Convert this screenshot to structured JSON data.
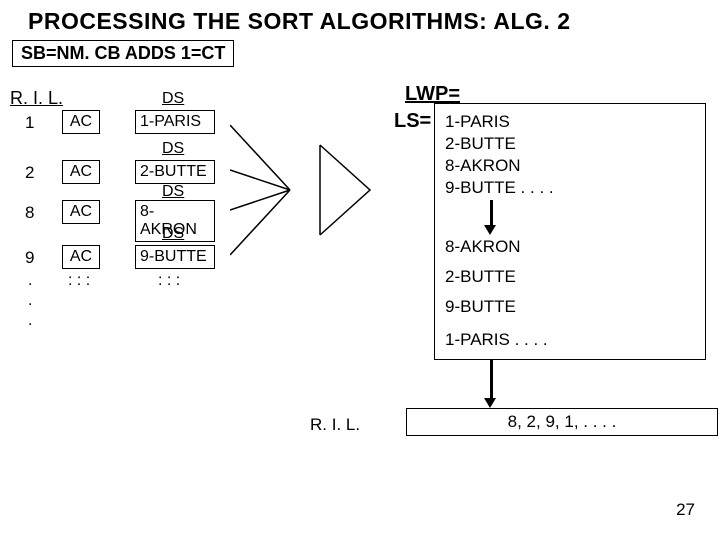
{
  "title": "PROCESSING   THE SORT ALGORITHMS:  ALG. 2",
  "subtitle": "SB=NM.  CB ADDS 1=CT",
  "ril_label": "R. I. L.",
  "rows": [
    {
      "num": "1",
      "ac": "AC",
      "ds_label": "DS",
      "ds": "1-PARIS"
    },
    {
      "num": "2",
      "ac": "AC",
      "ds_label": "DS",
      "ds": "2-BUTTE"
    },
    {
      "num": "8",
      "ac": "AC",
      "ds_label": "DS",
      "ds": "8-AKRON"
    },
    {
      "num": "9",
      "ac": "AC",
      "ds_label": "DS",
      "ds": "9-BUTTE"
    }
  ],
  "trailing_nums": [
    ".",
    ".",
    "."
  ],
  "ac_dots": ": : :",
  "ds_dots": ": : :",
  "lwp_label": "LWP=",
  "ls_label": "LS=",
  "ls_lines": [
    "1-PARIS",
    "2-BUTTE",
    "8-AKRON",
    "9-BUTTE . . . ."
  ],
  "sorted_lines": [
    "8-AKRON",
    "2-BUTTE",
    "9-BUTTE",
    "1-PARIS . . . ."
  ],
  "ril2_label": "R. I. L.",
  "result": "8, 2, 9, 1, . . . .",
  "page": "27",
  "chart_data": {
    "type": "diagram",
    "description": "Sort algorithm processing: records with AC/DS fields merge into LS list, then sorted alphabetically, producing R.I.L. index order",
    "input_records": [
      {
        "ril": 1,
        "ds": "1-PARIS"
      },
      {
        "ril": 2,
        "ds": "2-BUTTE"
      },
      {
        "ril": 8,
        "ds": "8-AKRON"
      },
      {
        "ril": 9,
        "ds": "9-BUTTE"
      }
    ],
    "ls_unsorted": [
      "1-PARIS",
      "2-BUTTE",
      "8-AKRON",
      "9-BUTTE"
    ],
    "ls_sorted": [
      "8-AKRON",
      "2-BUTTE",
      "9-BUTTE",
      "1-PARIS"
    ],
    "output_ril": [
      8,
      2,
      9,
      1
    ]
  }
}
